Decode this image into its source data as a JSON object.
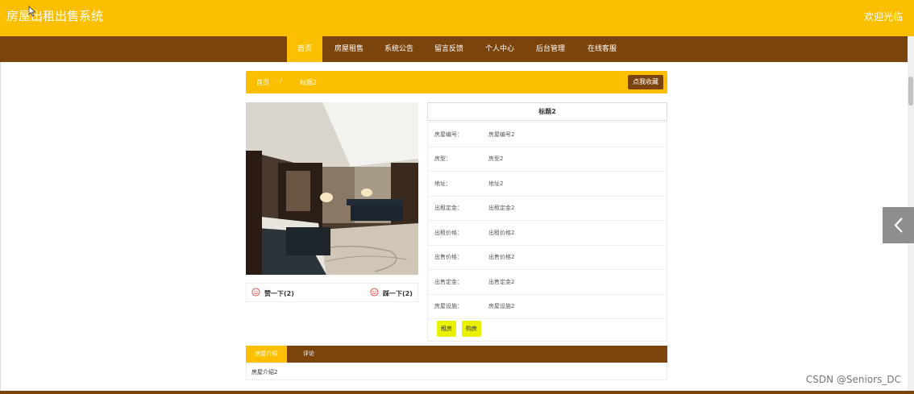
{
  "header": {
    "site_title": "房屋出租出售系统",
    "welcome": "欢迎光临"
  },
  "nav": {
    "items": [
      {
        "label": "首页",
        "active": true
      },
      {
        "label": "房屋租售",
        "active": false
      },
      {
        "label": "系统公告",
        "active": false
      },
      {
        "label": "留言反馈",
        "active": false
      },
      {
        "label": "个人中心",
        "active": false
      },
      {
        "label": "后台管理",
        "active": false
      },
      {
        "label": "在线客服",
        "active": false
      }
    ]
  },
  "breadcrumb": {
    "home": "首页",
    "separator": "/",
    "current": "标题2",
    "favorite_button": "点我收藏"
  },
  "votes": {
    "up_label": "赞一下(2)",
    "down_label": "踩一下(2)"
  },
  "detail": {
    "title": "标题2",
    "fields": [
      {
        "key": "房屋编号：",
        "value": "房屋编号2"
      },
      {
        "key": "房型：",
        "value": "房型2"
      },
      {
        "key": "地址：",
        "value": "地址2"
      },
      {
        "key": "出租定金：",
        "value": "出租定金2"
      },
      {
        "key": "出租价格：",
        "value": "出租价格2"
      },
      {
        "key": "出售价格：",
        "value": "出售价格2"
      },
      {
        "key": "出售定金：",
        "value": "出售定金2"
      },
      {
        "key": "房屋设施：",
        "value": "房屋设施2"
      }
    ],
    "rent_button": "租房",
    "buy_button": "购房"
  },
  "tabs": {
    "intro": "房屋介绍",
    "comments": "评论",
    "intro_text": "房屋介绍2"
  },
  "watermark": "CSDN @Seniors_DC",
  "colors": {
    "primary": "#fcbf00",
    "nav_bg": "#7b440d",
    "action_button": "#eaf100"
  },
  "icons": {
    "vote_up": "smile-icon",
    "vote_down": "smile-icon",
    "side": "chevron-left-icon"
  }
}
